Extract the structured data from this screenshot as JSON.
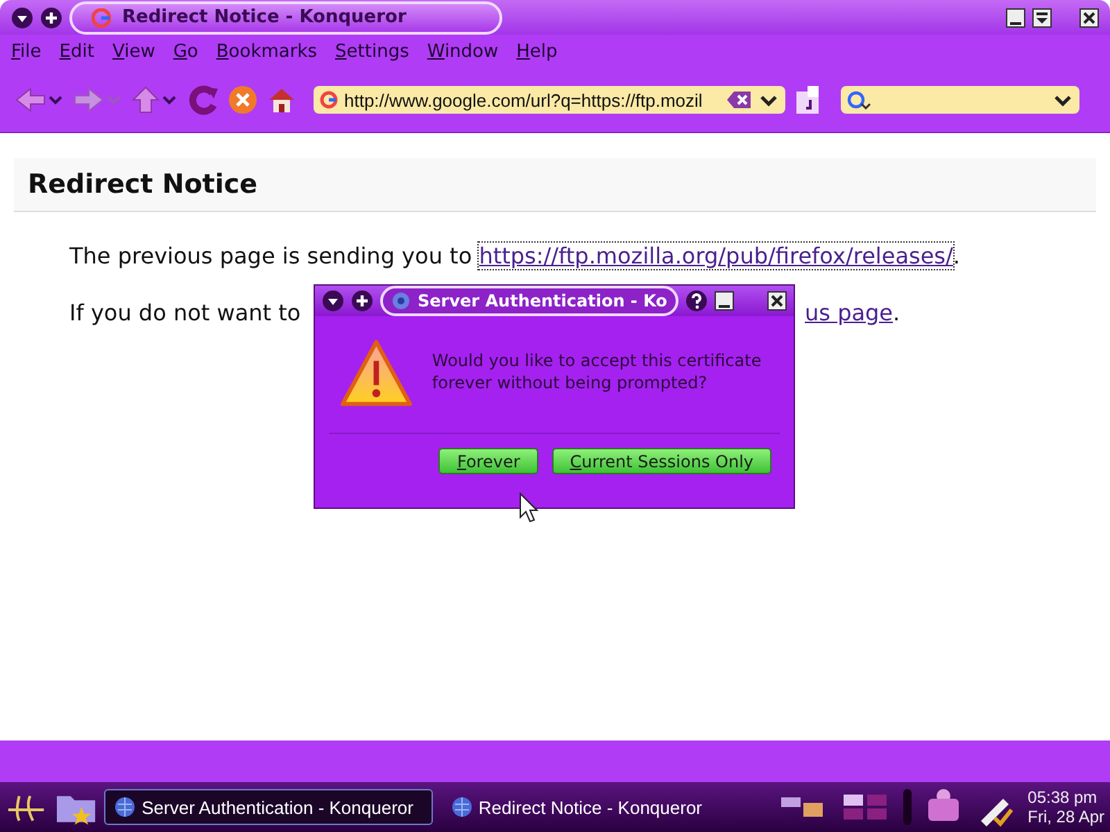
{
  "window": {
    "title": "Redirect Notice - Konqueror"
  },
  "menu": [
    "File",
    "Edit",
    "View",
    "Go",
    "Bookmarks",
    "Settings",
    "Window",
    "Help"
  ],
  "toolbar": {
    "url": "http://www.google.com/url?q=https://ftp.mozil"
  },
  "page": {
    "heading": "Redirect Notice",
    "line1": {
      "text": "The previous page is sending you to",
      "link": "https://ftp.mozilla.org/pub/firefox/releases/",
      "end": "."
    },
    "line2": {
      "text": "If you do not want to",
      "link": "us page",
      "end": "."
    }
  },
  "dialog": {
    "title": "Server Authentication - Ko",
    "message": "Would you like to accept this certificate forever without being prompted?",
    "buttons": [
      "Forever",
      "Current Sessions Only"
    ]
  },
  "taskbar": {
    "tasks": [
      {
        "label": "Server Authentication - Konqueror",
        "selected": true
      },
      {
        "label": "Redirect Notice - Konqueror",
        "selected": false
      }
    ],
    "clock": {
      "time": "05:38 pm",
      "date": "Fri, 28 Apr"
    }
  }
}
